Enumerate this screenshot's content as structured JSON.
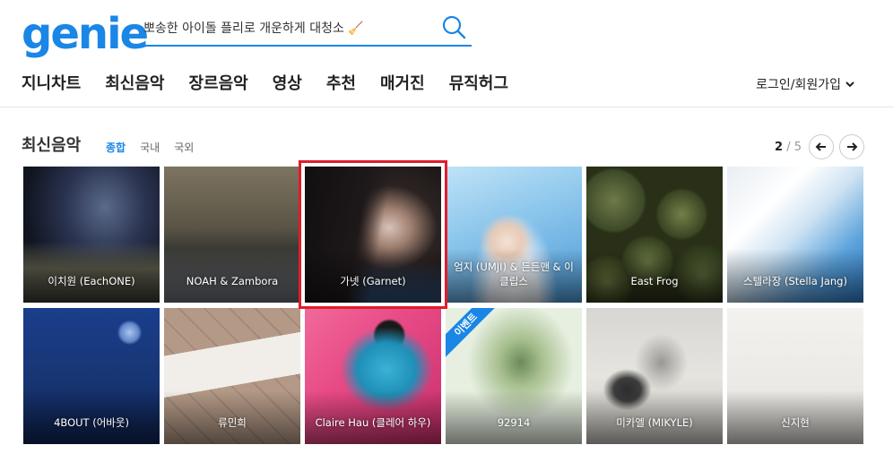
{
  "header": {
    "logo": "genie",
    "search_placeholder": "뽀송한 아이돌 플리로 개운하게 대청소 🧹"
  },
  "nav": [
    "지니차트",
    "최신음악",
    "장르음악",
    "영상",
    "추천",
    "매거진",
    "뮤직허그"
  ],
  "auth_label": "로그인/회원가입",
  "section": {
    "title": "최신음악",
    "tabs": [
      "종합",
      "국내",
      "국외"
    ],
    "active_tab": "종합",
    "page_current": "2",
    "page_total": "/ 5"
  },
  "albums": [
    {
      "artist": "이치원 (EachONE)"
    },
    {
      "artist": "NOAH & Zambora"
    },
    {
      "artist": "가넷 (Garnet)"
    },
    {
      "artist": "엄지 (UMJI) & 든든맨 & 이클립스"
    },
    {
      "artist": "East Frog"
    },
    {
      "artist": "스텔라장 (Stella Jang)"
    },
    {
      "artist": "4BOUT (어바웃)"
    },
    {
      "artist": "류민희"
    },
    {
      "artist": "Claire Hau (클레어 하우)"
    },
    {
      "artist": "92914",
      "badge": "이벤트"
    },
    {
      "artist": "미카엘 (MIKYLE)"
    },
    {
      "artist": "신지현"
    }
  ],
  "colors": {
    "brand": "#1a86e6",
    "highlight": "#e11d2a"
  }
}
